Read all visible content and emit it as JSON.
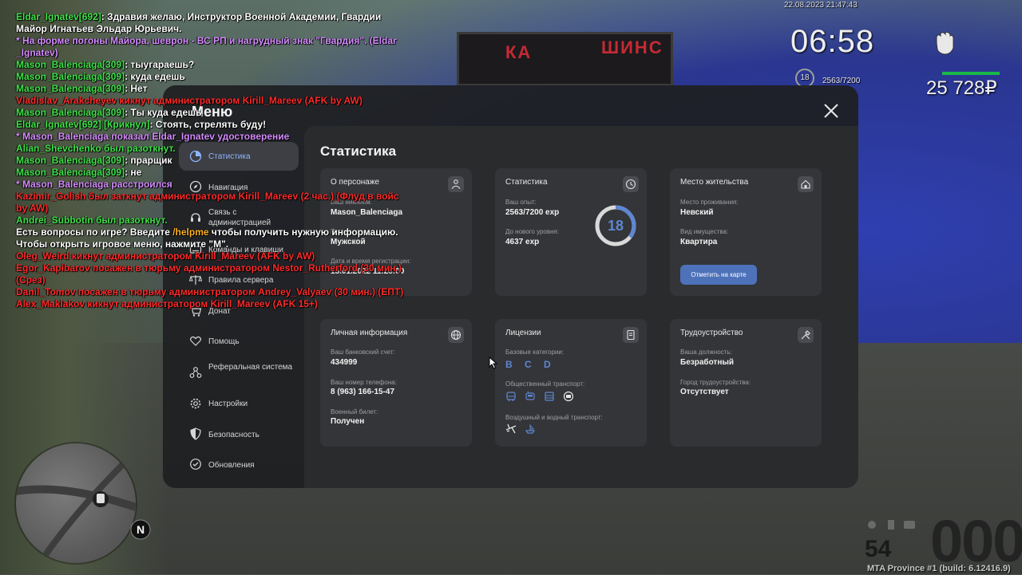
{
  "hud": {
    "datetime": "22.08.2023 21:47:43",
    "clock": "06:58",
    "level": "18",
    "exp": "2563/7200",
    "money": "25 728₽",
    "speed": "000",
    "fuel": "54",
    "build": "MTA Province #1 (build: 6.12416.9)",
    "compass": "N"
  },
  "world": {
    "sign_left": "КА",
    "sign_right": "ШИНС"
  },
  "chat": [
    {
      "parts": [
        {
          "t": "Eldar_Ignatev[692]",
          "c": "green"
        },
        {
          "t": ": Здравия желаю, Инструктор Военной Академии, Гвардии",
          "c": "white"
        }
      ]
    },
    {
      "parts": [
        {
          "t": " Майор Игнатьев Эльдар Юрьевич.",
          "c": "white"
        }
      ]
    },
    {
      "parts": [
        {
          "t": "* На форме погоны Майора, шеврон - ВС РП и нагрудный знак \"Гвардия\". (Eldar",
          "c": "purple"
        }
      ]
    },
    {
      "parts": [
        {
          "t": " _Ignatev)",
          "c": "purple"
        }
      ]
    },
    {
      "parts": [
        {
          "t": "Mason_Balenciaga[309]",
          "c": "green"
        },
        {
          "t": ": тыугараешь?",
          "c": "white"
        }
      ]
    },
    {
      "parts": [
        {
          "t": "Mason_Balenciaga[309]",
          "c": "green"
        },
        {
          "t": ": куда едешь",
          "c": "white"
        }
      ]
    },
    {
      "parts": [
        {
          "t": "Mason_Balenciaga[309]",
          "c": "green"
        },
        {
          "t": ": Нет",
          "c": "white"
        }
      ]
    },
    {
      "parts": [
        {
          "t": "Vladislav_Arakcheyev кикнут администратором Kirill_Mareev (AFK by AW)",
          "c": "red"
        }
      ]
    },
    {
      "parts": [
        {
          "t": "Mason_Balenciaga[309]",
          "c": "green"
        },
        {
          "t": ": Ты куда едешь",
          "c": "white"
        }
      ]
    },
    {
      "parts": [
        {
          "t": "Eldar_Ignatev[692] [Крикнул]",
          "c": "green"
        },
        {
          "t": ": Стоять, стрелять буду!",
          "c": "white"
        }
      ]
    },
    {
      "parts": [
        {
          "t": "* Mason_Balenciaga показал Eldar_Ignatev удостоверение",
          "c": "purple"
        }
      ]
    },
    {
      "parts": [
        {
          "t": "Alian_Shevchenko был разоткнут.",
          "c": "green"
        }
      ]
    },
    {
      "parts": [
        {
          "t": "Mason_Balenciaga[309]",
          "c": "green"
        },
        {
          "t": ": прарщик",
          "c": "white"
        }
      ]
    },
    {
      "parts": [
        {
          "t": "Mason_Balenciaga[309]",
          "c": "green"
        },
        {
          "t": ": не",
          "c": "white"
        }
      ]
    },
    {
      "parts": [
        {
          "t": "* Mason_Balenciaga расстроился",
          "c": "purple"
        }
      ]
    },
    {
      "parts": [
        {
          "t": "Kazimir_Golish был заткнут администратором Kirill_Mareev (2 час.) (Флуд в войс",
          "c": "red"
        }
      ]
    },
    {
      "parts": [
        {
          "t": " by AW)",
          "c": "red"
        }
      ]
    },
    {
      "parts": [
        {
          "t": "Andrei_Subbotin был разоткнут.",
          "c": "green"
        }
      ]
    },
    {
      "parts": [
        {
          "t": "Есть вопросы по игре? Введите ",
          "c": "white"
        },
        {
          "t": "/helpme",
          "c": "orange"
        },
        {
          "t": " чтобы получить нужную информацию.",
          "c": "white"
        }
      ]
    },
    {
      "parts": [
        {
          "t": "Чтобы открыть игровое меню, нажмите \"М\".",
          "c": "white"
        }
      ]
    },
    {
      "parts": [
        {
          "t": "Oleg_Weird кикнут администратором Kirill_Mareev (AFK by AW)",
          "c": "red"
        }
      ]
    },
    {
      "parts": [
        {
          "t": "Egor_Kapibarov посажен в тюрьму администратором Nestor_Rutherford (30 мин.)",
          "c": "red"
        }
      ]
    },
    {
      "parts": [
        {
          "t": " (Срез)",
          "c": "red"
        }
      ]
    },
    {
      "parts": [
        {
          "t": "Danil_Tomov посажен в тюрьму администратором Andrey_Valyaev (30 мин.) (ЕПТ)",
          "c": "red"
        }
      ]
    },
    {
      "parts": [
        {
          "t": "Alex_Maklakov кикнут администратором Kirill_Mareev (AFK 15+)",
          "c": "red"
        }
      ]
    }
  ],
  "menu": {
    "title": "Меню",
    "section_title": "Статистика",
    "nav": [
      {
        "label": "Статистика",
        "icon": "chart-icon",
        "active": true
      },
      {
        "label": "Навигация",
        "icon": "compass-icon"
      },
      {
        "label": "Связь с администрацией",
        "icon": "headset-icon"
      },
      {
        "label": "Команды и клавиши",
        "icon": "keyboard-icon"
      },
      {
        "label": "Правила сервера",
        "icon": "scales-icon"
      },
      {
        "label": "Донат",
        "icon": "cart-icon"
      },
      {
        "label": "Помощь",
        "icon": "heart-hands-icon"
      },
      {
        "label": "Реферальная система",
        "icon": "network-icon"
      },
      {
        "label": "Настройки",
        "icon": "gear-icon"
      },
      {
        "label": "Безопасность",
        "icon": "shield-icon"
      },
      {
        "label": "Обновления",
        "icon": "refresh-icon"
      }
    ],
    "cards": {
      "character": {
        "title": "О персонаже",
        "icon": "person-icon",
        "nickname_label": "Ваш никнейм:",
        "nickname": "Mason_Balenciaga",
        "gender_label": "Пол:",
        "gender": "Мужской",
        "reg_label": "Дата и время регистрации:",
        "reg": "15.01.2022 11:28:00"
      },
      "stats": {
        "title": "Статистика",
        "icon": "clock-icon",
        "exp_label": "Ваш опыт:",
        "exp": "2563/7200 exp",
        "next_label": "До нового уровня:",
        "next": "4637 exp",
        "level": "18",
        "progress": 0.356
      },
      "residence": {
        "title": "Место жительства",
        "icon": "home-icon",
        "place_label": "Место проживания:",
        "place": "Невский",
        "property_label": "Вид имущества:",
        "property": "Квартира",
        "button": "Отметить на карте"
      },
      "personal": {
        "title": "Личная информация",
        "icon": "globe-icon",
        "bank_label": "Ваш банковский счет:",
        "bank": "434999",
        "phone_label": "Ваш номер телефона:",
        "phone": "8 (963) 166-15-47",
        "military_label": "Военный билет:",
        "military": "Получен"
      },
      "licenses": {
        "title": "Лицензии",
        "icon": "document-icon",
        "base_label": "Базовые категории:",
        "base": "B C D",
        "public_label": "Общественный транспорт:",
        "air_label": "Воздушный и водный транспорт:"
      },
      "job": {
        "title": "Трудоустройство",
        "icon": "tools-icon",
        "position_label": "Ваша должность:",
        "position": "Безработный",
        "city_label": "Город трудоустройства:",
        "city": "Отсутствует"
      }
    }
  }
}
